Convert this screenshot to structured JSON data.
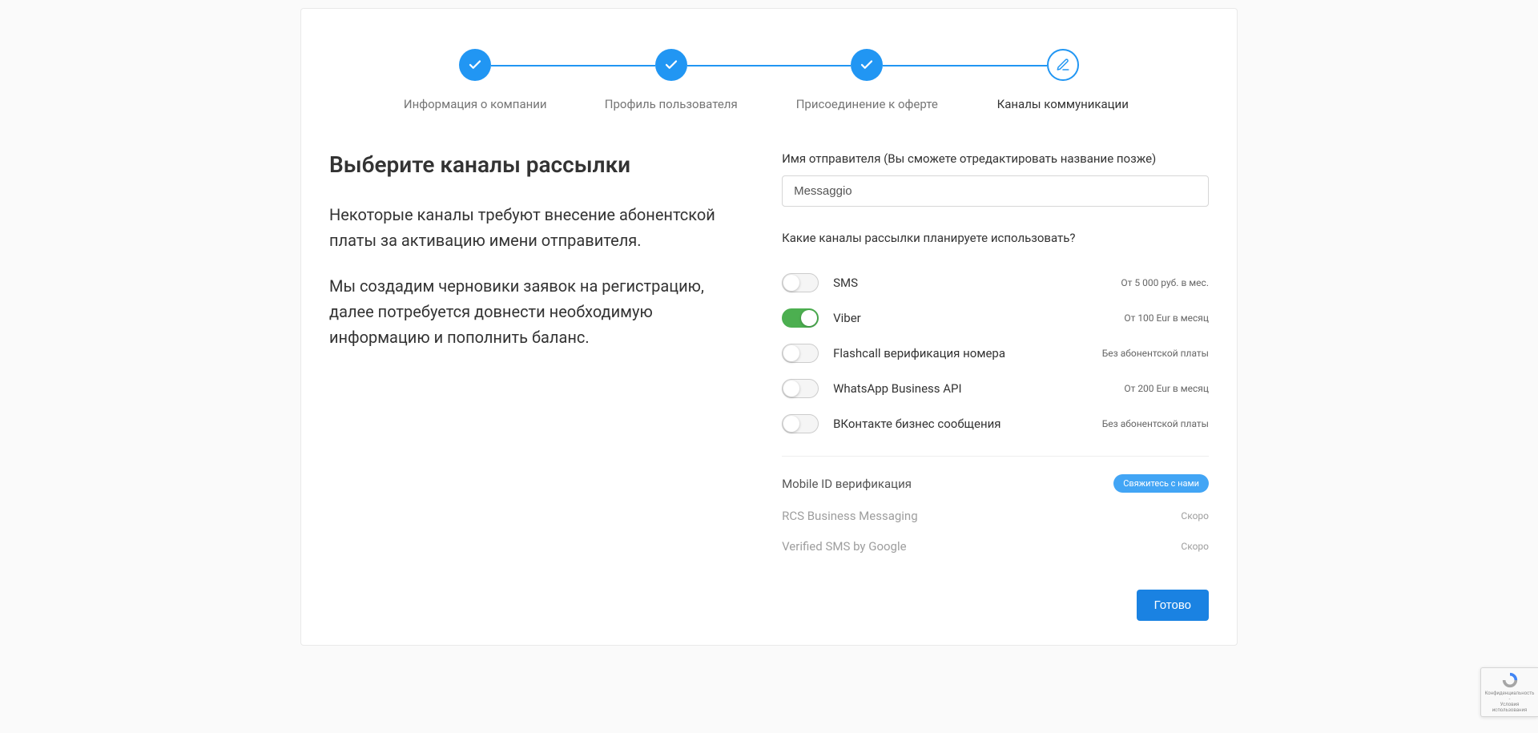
{
  "stepper": {
    "steps": [
      {
        "label": "Информация о компании",
        "state": "done"
      },
      {
        "label": "Профиль пользователя",
        "state": "done"
      },
      {
        "label": "Присоединение к оферте",
        "state": "done"
      },
      {
        "label": "Каналы коммуникации",
        "state": "current"
      }
    ]
  },
  "left": {
    "heading": "Выберите каналы рассылки",
    "p1": "Некоторые каналы требуют внесение абонентской платы за активацию имени отправителя.",
    "p2": "Мы создадим черновики заявок на регистрацию, далее потребуется довнести необходимую информацию и пополнить баланс."
  },
  "form": {
    "sender_label": "Имя отправителя (Вы сможете отредактировать название позже)",
    "sender_value": "Messaggio",
    "channels_question": "Какие каналы рассылки планируете использовать?",
    "channels": [
      {
        "name": "SMS",
        "price": "От 5 000 руб. в мес.",
        "on": false
      },
      {
        "name": "Viber",
        "price": "От 100 Eur в месяц",
        "on": true
      },
      {
        "name": "Flashcall верификация номера",
        "price": "Без абонентской платы",
        "on": false
      },
      {
        "name": "WhatsApp Business API",
        "price": "От 200 Eur в месяц",
        "on": false
      },
      {
        "name": "ВКонтакте бизнес сообщения",
        "price": "Без абонентской платы",
        "on": false
      }
    ],
    "extra": [
      {
        "name": "Mobile ID верификация",
        "badge_type": "contact",
        "badge": "Свяжитесь с нами"
      },
      {
        "name": "RCS Business Messaging",
        "badge_type": "soon",
        "badge": "Скоро"
      },
      {
        "name": "Verified SMS by Google",
        "badge_type": "soon",
        "badge": "Скоро"
      }
    ],
    "submit_label": "Готово"
  },
  "recaptcha": {
    "line1": "Конфиденциальность -",
    "line2": "Условия использования"
  }
}
